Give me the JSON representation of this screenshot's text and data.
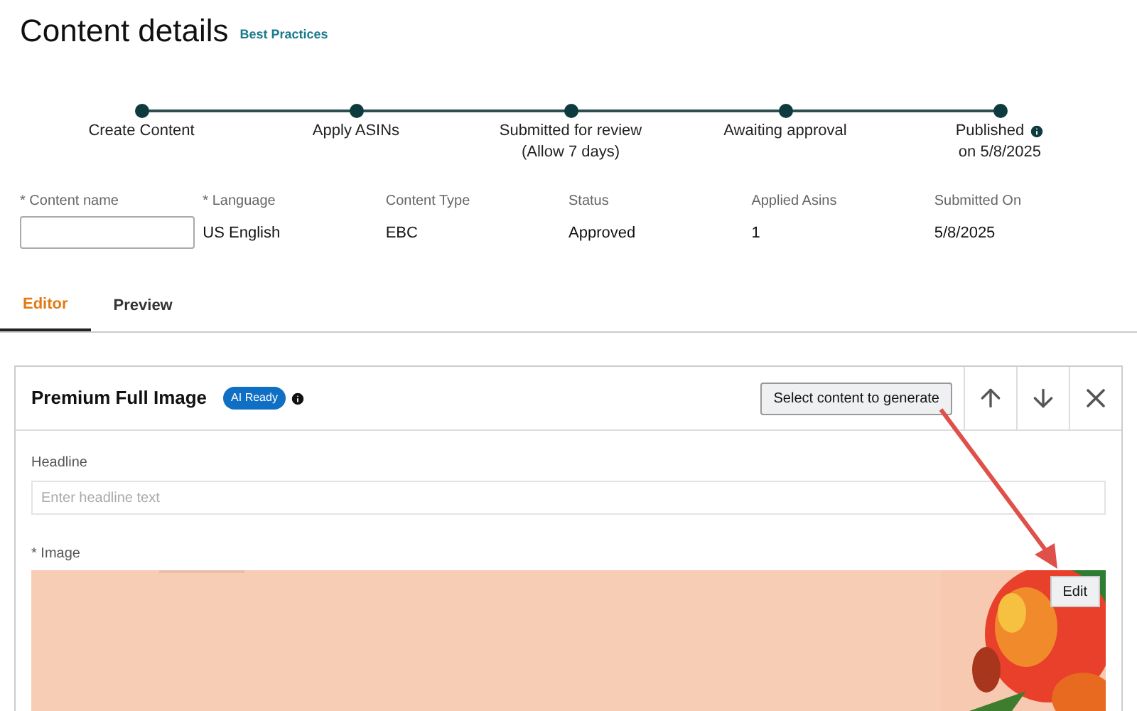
{
  "header": {
    "title": "Content details",
    "link": "Best Practices"
  },
  "steps": [
    {
      "label": "Create Content",
      "info": false
    },
    {
      "label": "Apply ASINs",
      "info": false
    },
    {
      "label": "Submitted for review\n(Allow 7 days)",
      "info": false
    },
    {
      "label": "Awaiting approval",
      "info": false
    },
    {
      "label": "Published",
      "sub": "on 5/8/2025",
      "info": true
    }
  ],
  "fields": [
    {
      "label": "* Content name",
      "kind": "input"
    },
    {
      "label": "* Language",
      "value": "US English",
      "kind": "text"
    },
    {
      "label": "Content Type",
      "value": "EBC",
      "kind": "text"
    },
    {
      "label": "Status",
      "value": "Approved",
      "kind": "text"
    },
    {
      "label": "Applied Asins",
      "value": "1",
      "kind": "text"
    },
    {
      "label": "Submitted On",
      "value": "5/8/2025",
      "kind": "text"
    }
  ],
  "tabs": [
    {
      "label": "Editor",
      "selected": true
    },
    {
      "label": "Preview",
      "selected": false
    }
  ],
  "module": {
    "title": "Premium Full Image",
    "badge": "AI Ready",
    "generate_button": "Select content to generate",
    "headline": {
      "label": "Headline",
      "placeholder": "Enter headline text"
    },
    "image": {
      "label": "* Image",
      "edit_button": "Edit",
      "kind": "picture"
    }
  }
}
